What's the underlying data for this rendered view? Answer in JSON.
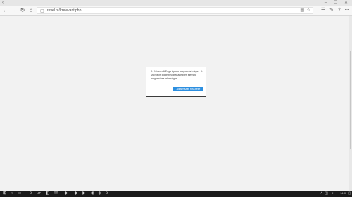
{
  "browser": {
    "url": "revel.rc/Irrelevant.php"
  },
  "dialog": {
    "message": "Az Microsoft Edge éppen megoszást végez. Az Microsoft Edge beállításai egyes elemek megosztása lehetséges.",
    "button_label": "Alkalmazás frissítése"
  },
  "taskbar": {
    "time": "14:00"
  }
}
